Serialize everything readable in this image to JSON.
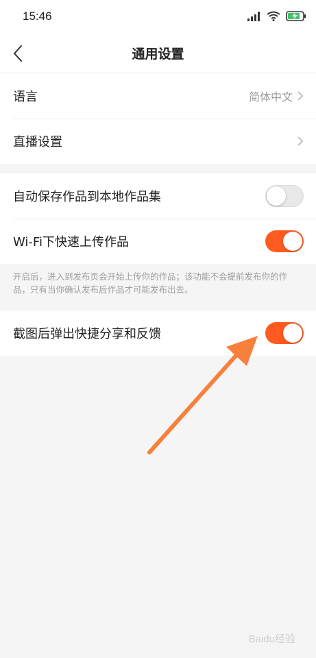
{
  "status_bar": {
    "time": "15:46"
  },
  "nav": {
    "title": "通用设置"
  },
  "rows": {
    "language": {
      "label": "语言",
      "value": "简体中文"
    },
    "live": {
      "label": "直播设置"
    },
    "auto_save": {
      "label": "自动保存作品到本地作品集",
      "state": "off"
    },
    "wifi_upload": {
      "label": "Wi-Fi下快速上传作品",
      "state": "on"
    },
    "screenshot_share": {
      "label": "截图后弹出快捷分享和反馈",
      "state": "on"
    }
  },
  "note": "开启后，进入到发布页会开始上传你的作品；该功能不会提前发布你的作品，只有当你确认发布后作品才可能发布出去。",
  "watermark": "Baidu经验",
  "colors": {
    "accent": "#ff5a1f",
    "arrow": "#f7803c"
  }
}
